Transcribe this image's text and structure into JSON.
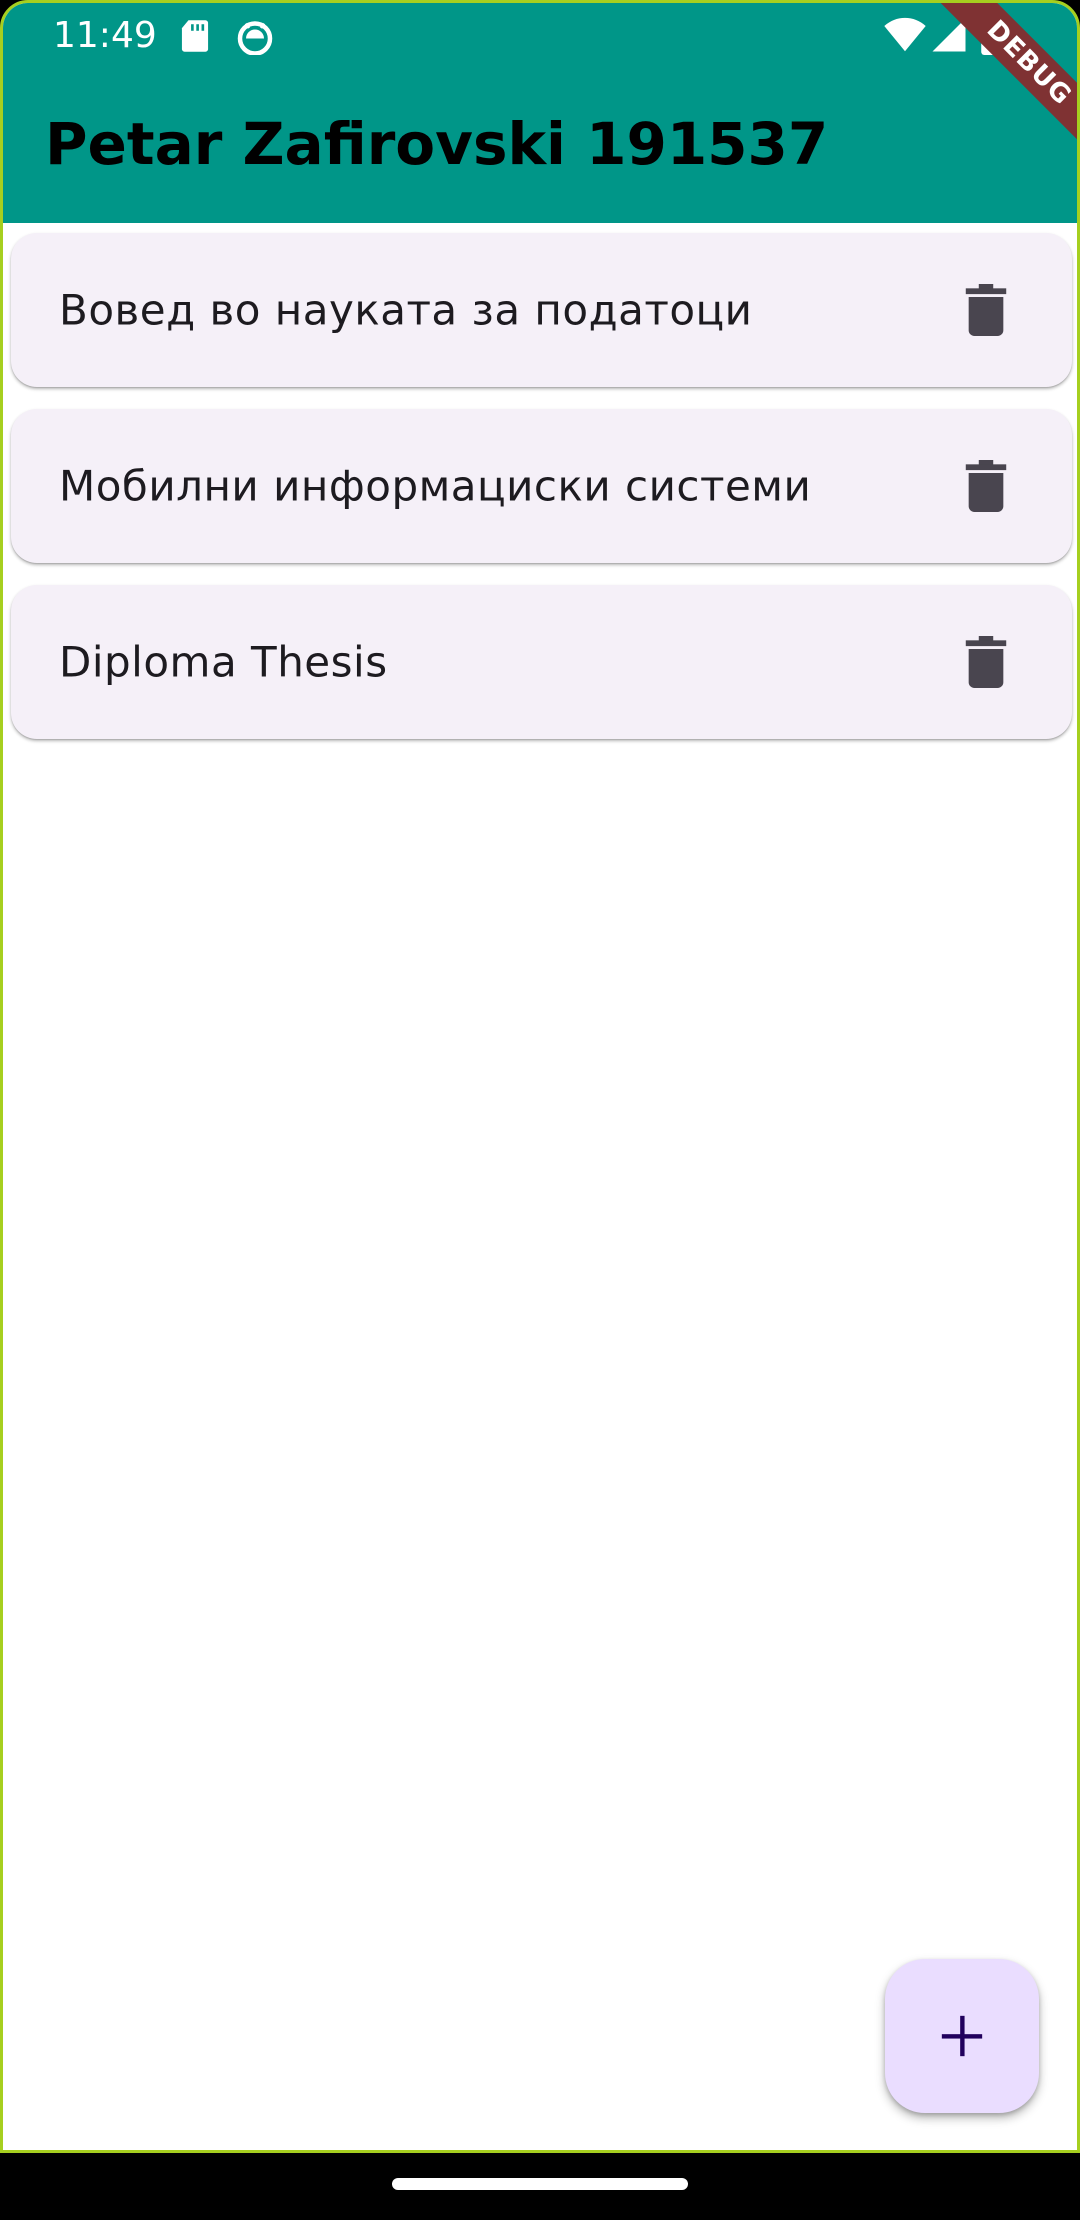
{
  "status_bar": {
    "time": "11:49",
    "left_icons": [
      "sd-card-icon",
      "android-debug-icon"
    ],
    "right_icons": [
      "wifi-icon",
      "signal-icon",
      "battery-icon"
    ]
  },
  "app_bar": {
    "title": "Petar Zafirovski 191537",
    "color": "#009688"
  },
  "debug_banner": {
    "label": "DEBUG"
  },
  "courses": [
    {
      "title": "Вовед во науката за податоци",
      "action_icon": "delete-icon"
    },
    {
      "title": "Мобилни информациски системи",
      "action_icon": "delete-icon"
    },
    {
      "title": "Diploma Thesis",
      "action_icon": "delete-icon"
    }
  ],
  "fab": {
    "icon": "add-icon",
    "color": "#eaddff"
  },
  "colors": {
    "card_background": "#f5f0f8",
    "icon": "#49454f",
    "fab_icon": "#21005d"
  }
}
